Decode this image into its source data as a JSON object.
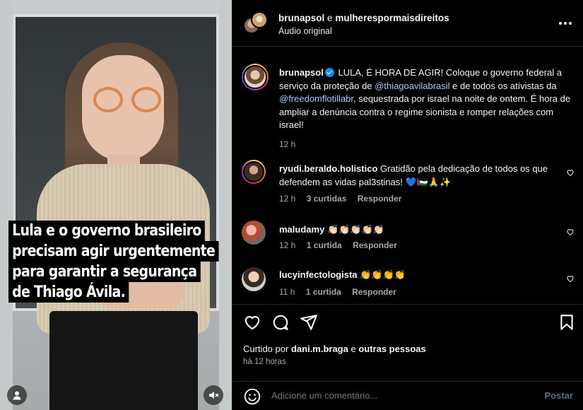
{
  "video": {
    "caption_lines": [
      "Lula e o governo brasileiro",
      "precisam agir urgentemente",
      "para garantir a segurança",
      "de Thiago Ávila."
    ]
  },
  "header": {
    "user1": "brunapsol",
    "and_word": "e",
    "user2": "mulherespormaisdireitos",
    "subtitle": "Áudio original"
  },
  "post": {
    "username": "brunapsol",
    "text_part1": "LULA, É HORA DE AGIR! Coloque o governo federal a serviço da proteção de ",
    "mention1": "@thiagoavilabrasil",
    "text_part2": " e de todos os atívistas da ",
    "mention2": "@freedomflotillabr",
    "text_part3": ", sequestrada por israel na noite de ontem. É hora de ampliar a denúncia contra o regime sionista e romper relações com israel!",
    "time": "12 h"
  },
  "comments": [
    {
      "username": "ryudi.beraldo.holistico",
      "text": "Gratidão pela dedicação de todos os que defendem as vidas pal3stinas! 💙🇵🇸🙏✨",
      "time": "12 h",
      "likes": "3 curtidas",
      "reply": "Responder"
    },
    {
      "username": "maludamy",
      "text": "👏🏻👏🏻👏🏻👏🏻👏🏻",
      "time": "12 h",
      "likes": "1 curtida",
      "reply": "Responder"
    },
    {
      "username": "lucyinfectologista",
      "text": "👏👏👏👏",
      "time": "11 h",
      "likes": "1 curtida",
      "reply": "Responder"
    }
  ],
  "footer": {
    "liked_prefix": "Curtido por",
    "liked_user": "dani.m.braga",
    "liked_and": "e",
    "liked_others": "outras pessoas",
    "time": "há 12 horas",
    "comment_placeholder": "Adicione um comentário...",
    "post_button": "Postar"
  },
  "icons": {
    "more": "more-options-icon",
    "like": "heart-icon",
    "comment": "comment-icon",
    "share": "share-icon",
    "save": "bookmark-icon",
    "emoji": "emoji-icon",
    "user": "user-tag-icon",
    "mute": "sound-off-icon"
  },
  "colors": {
    "background": "#000000",
    "text": "#f5f5f5",
    "secondary": "#a8a8a8",
    "mention": "#a6c8ff",
    "verified": "#0095f6"
  }
}
